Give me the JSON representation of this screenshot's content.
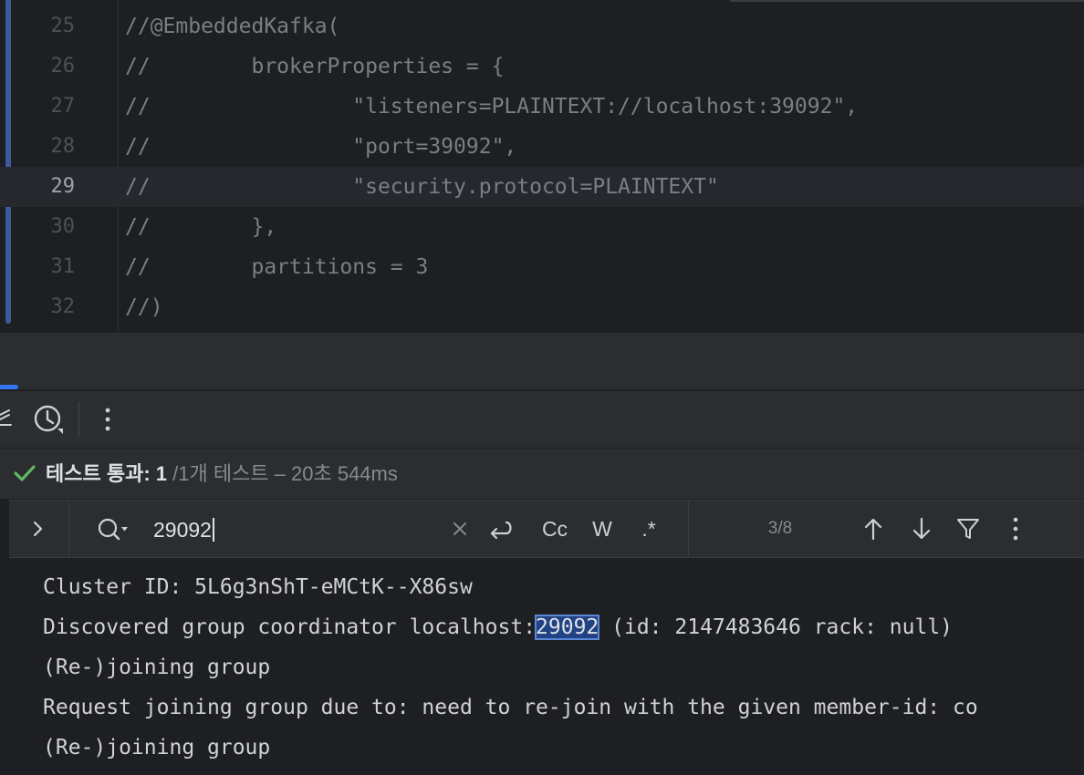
{
  "editor": {
    "lines": [
      {
        "num": "25",
        "code": "//@EmbeddedKafka("
      },
      {
        "num": "26",
        "code": "//        brokerProperties = {"
      },
      {
        "num": "27",
        "code": "//                \"listeners=PLAINTEXT://localhost:39092\","
      },
      {
        "num": "28",
        "code": "//                \"port=39092\","
      },
      {
        "num": "29",
        "code": "//                \"security.protocol=PLAINTEXT\""
      },
      {
        "num": "30",
        "code": "//        },"
      },
      {
        "num": "31",
        "code": "//        partitions = 3"
      },
      {
        "num": "32",
        "code": "//)"
      }
    ],
    "current_line": "29"
  },
  "toolbar": {
    "icons": [
      "sort-icon",
      "history-icon",
      "more-vertical-icon"
    ]
  },
  "status": {
    "passed_label": "테스트 통과: 1",
    "detail": "/1개 테스트 – 20초 544ms"
  },
  "search": {
    "query": "29092",
    "match_case_label": "Cc",
    "words_label": "W",
    "regex_label": ".*",
    "match_count": "3/8"
  },
  "console": {
    "line1": "Cluster ID: 5L6g3nShT-eMCtK--X86sw",
    "line2_before": "Discovered group coordinator localhost:",
    "line2_match": "29092",
    "line2_after": " (id: 2147483646 rack: null)",
    "line3": "(Re-)joining group",
    "line4": "Request joining group due to: need to re-join with the given member-id: co",
    "line5": "(Re-)joining group"
  },
  "colors": {
    "editor_bg": "#1e1f22",
    "panel_bg": "#2b2d30",
    "accent": "#3574f0",
    "success": "#5fb865",
    "match_highlight": "#214283"
  }
}
